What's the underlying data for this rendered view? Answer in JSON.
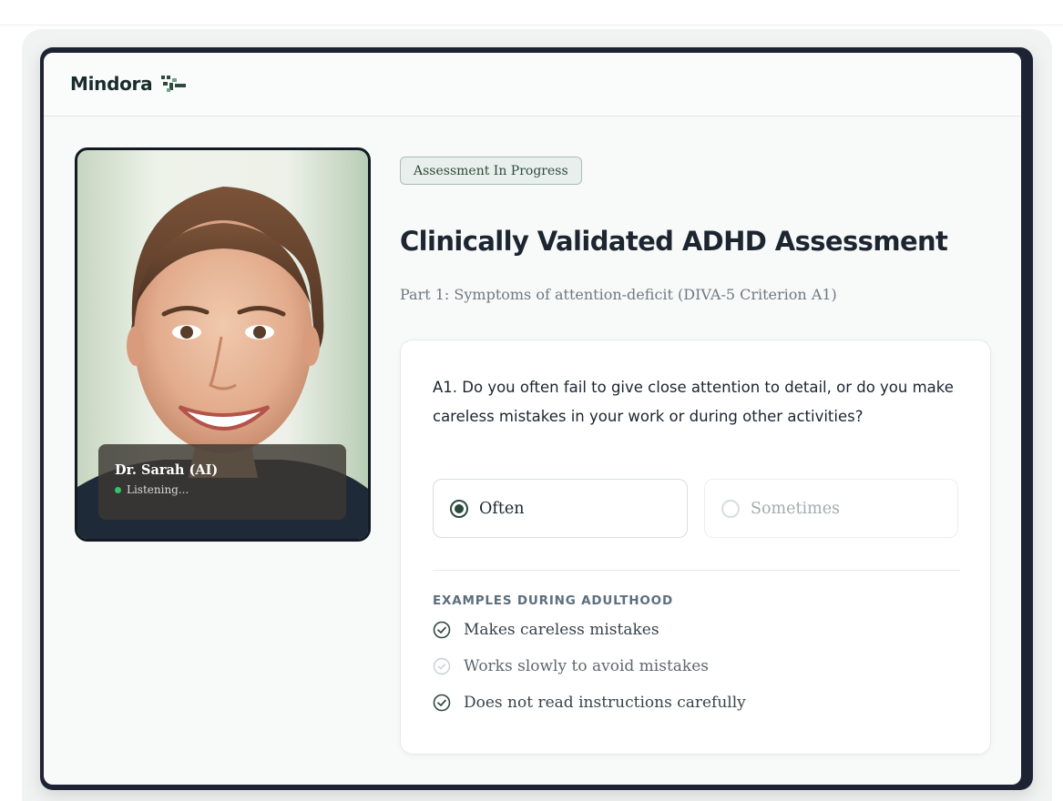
{
  "app": {
    "brand_name": "Mindora"
  },
  "avatar": {
    "name": "Dr. Sarah (AI)",
    "status": "Listening..."
  },
  "assessment": {
    "status_badge": "Assessment In Progress",
    "title": "Clinically Validated ADHD Assessment",
    "subtitle": "Part 1: Symptoms of attention-deficit (DIVA-5 Criterion A1)"
  },
  "question": {
    "text": "A1. Do you often fail to give close attention to detail, or do you make careless mistakes in your work or during other activities?",
    "options": [
      {
        "label": "Often",
        "selected": true
      },
      {
        "label": "Sometimes",
        "selected": false
      }
    ]
  },
  "examples": {
    "title": "EXAMPLES DURING ADULTHOOD",
    "items": [
      {
        "label": "Makes careless mistakes",
        "checked": true
      },
      {
        "label": "Works slowly to avoid mistakes",
        "checked": false
      },
      {
        "label": "Does not read instructions carefully",
        "checked": true
      }
    ]
  },
  "colors": {
    "accent": "#2a4a3d",
    "frame": "#1d2333",
    "status_green": "#38c16a",
    "check_on": "#2e4a3f",
    "check_off": "#c9cfd2"
  },
  "icons": {
    "logo": "mindora-logo-icon",
    "check_on": "check-circle-icon",
    "check_off": "check-circle-icon",
    "status": "status-dot-icon"
  }
}
